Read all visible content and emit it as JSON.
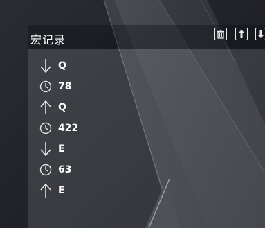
{
  "panel": {
    "title": "宏记录",
    "toolbar": [
      {
        "name": "delete-button",
        "icon": "trash-icon"
      },
      {
        "name": "move-up-button",
        "icon": "arrow-up-icon"
      },
      {
        "name": "move-down-button",
        "icon": "arrow-down-icon"
      }
    ]
  },
  "macro_events": [
    {
      "type": "key-down",
      "icon": "arrow-down-icon",
      "text": "Q"
    },
    {
      "type": "delay",
      "icon": "clock-icon",
      "text": "78"
    },
    {
      "type": "key-up",
      "icon": "arrow-up-icon",
      "text": "Q"
    },
    {
      "type": "delay",
      "icon": "clock-icon",
      "text": "422"
    },
    {
      "type": "key-down",
      "icon": "arrow-down-icon",
      "text": "E"
    },
    {
      "type": "delay",
      "icon": "clock-icon",
      "text": "63"
    },
    {
      "type": "key-up",
      "icon": "arrow-up-icon",
      "text": "E"
    }
  ]
}
